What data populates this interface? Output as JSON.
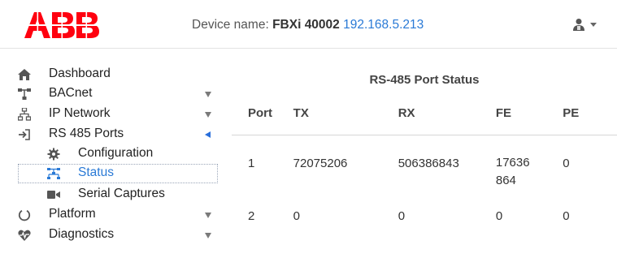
{
  "header": {
    "logo_text": "ABB",
    "device_label": "Device name:",
    "device_name": "FBXi 40002",
    "device_ip": "192.168.5.213",
    "brand_color": "#ff000f",
    "user_icon": "user-icon"
  },
  "sidebar": {
    "items": [
      {
        "label": "Dashboard",
        "icon": "home-icon"
      },
      {
        "label": "BACnet",
        "icon": "network-tree-icon"
      },
      {
        "label": "IP Network",
        "icon": "lan-icon"
      },
      {
        "label": "RS 485 Ports",
        "icon": "sign-in-icon"
      }
    ],
    "sub_items": [
      {
        "label": "Configuration",
        "icon": "gear-icon"
      },
      {
        "label": "Status",
        "icon": "topology-icon"
      },
      {
        "label": "Serial Captures",
        "icon": "video-camera-icon"
      }
    ],
    "items_after": [
      {
        "label": "Platform",
        "icon": "power-icon"
      },
      {
        "label": "Diagnostics",
        "icon": "heartbeat-icon"
      }
    ]
  },
  "panel": {
    "title": "RS-485 Port Status",
    "columns": [
      "Port",
      "TX",
      "RX",
      "FE",
      "PE"
    ],
    "rows": [
      [
        "1",
        "72075206",
        "506386843",
        "17636864",
        "0"
      ],
      [
        "2",
        "0",
        "0",
        "0",
        "0"
      ]
    ]
  },
  "colors": {
    "link_blue": "#2a7ad6",
    "active_arrow": "#2a6fdb"
  }
}
